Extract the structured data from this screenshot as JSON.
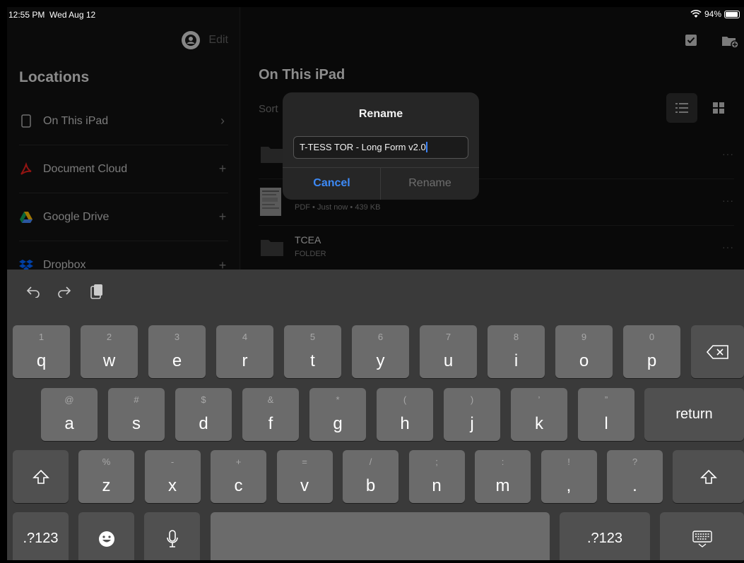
{
  "status_bar": {
    "time": "12:55 PM",
    "date": "Wed Aug 12",
    "battery": "94%",
    "battery_level": 0.94
  },
  "sidebar": {
    "edit_label": "Edit",
    "title": "Locations",
    "items": [
      {
        "label": "On This iPad",
        "action": "›",
        "icon": "ipad-icon"
      },
      {
        "label": "Document Cloud",
        "action": "+",
        "icon": "acrobat-icon"
      },
      {
        "label": "Google Drive",
        "action": "+",
        "icon": "google-drive-icon"
      },
      {
        "label": "Dropbox",
        "action": "+",
        "icon": "dropbox-icon"
      }
    ]
  },
  "main": {
    "title": "On This iPad",
    "sort_label": "Sort",
    "files": [
      {
        "name": "",
        "meta": "",
        "more": "···",
        "icon": "folder-icon"
      },
      {
        "name": "",
        "meta": "PDF • Just now • 439 KB",
        "more": "···",
        "icon": "pdf-thumbnail"
      },
      {
        "name": "TCEA",
        "meta": "FOLDER",
        "more": "···",
        "icon": "folder-icon"
      }
    ]
  },
  "dialog": {
    "title": "Rename",
    "input_value": "T-TESS TOR - Long Form v2.0",
    "cancel_label": "Cancel",
    "rename_label": "Rename",
    "accent": "#3d8af7"
  },
  "keyboard": {
    "row1": [
      {
        "hint": "1",
        "char": "q"
      },
      {
        "hint": "2",
        "char": "w"
      },
      {
        "hint": "3",
        "char": "e"
      },
      {
        "hint": "4",
        "char": "r"
      },
      {
        "hint": "5",
        "char": "t"
      },
      {
        "hint": "6",
        "char": "y"
      },
      {
        "hint": "7",
        "char": "u"
      },
      {
        "hint": "8",
        "char": "i"
      },
      {
        "hint": "9",
        "char": "o"
      },
      {
        "hint": "0",
        "char": "p"
      }
    ],
    "row2": [
      {
        "hint": "@",
        "char": "a"
      },
      {
        "hint": "#",
        "char": "s"
      },
      {
        "hint": "$",
        "char": "d"
      },
      {
        "hint": "&",
        "char": "f"
      },
      {
        "hint": "*",
        "char": "g"
      },
      {
        "hint": "(",
        "char": "h"
      },
      {
        "hint": ")",
        "char": "j"
      },
      {
        "hint": "’",
        "char": "k"
      },
      {
        "hint": "”",
        "char": "l"
      }
    ],
    "row3": [
      {
        "hint": "%",
        "char": "z"
      },
      {
        "hint": "-",
        "char": "x"
      },
      {
        "hint": "+",
        "char": "c"
      },
      {
        "hint": "=",
        "char": "v"
      },
      {
        "hint": "/",
        "char": "b"
      },
      {
        "hint": ";",
        "char": "n"
      },
      {
        "hint": ":",
        "char": "m"
      },
      {
        "hint": "!",
        "char": ","
      },
      {
        "hint": "?",
        "char": "."
      }
    ],
    "return_label": "return",
    "numbers_label": ".?123"
  }
}
